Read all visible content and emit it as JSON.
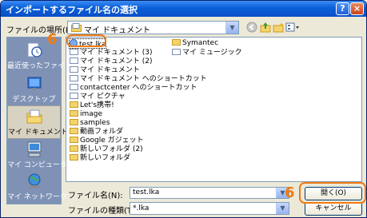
{
  "window": {
    "title": "インポートするファイル名の選択",
    "help_glyph": "?",
    "close_glyph": "×"
  },
  "lookin": {
    "label": "ファイルの場所(I):",
    "value": "マイ ドキュメント"
  },
  "toolbar": {
    "icons": [
      "back-icon",
      "up-folder-icon",
      "new-folder-icon",
      "view-menu-icon"
    ]
  },
  "places": [
    {
      "label": "最近使ったファイル",
      "icon": "recent-icon"
    },
    {
      "label": "デスクトップ",
      "icon": "desktop-icon"
    },
    {
      "label": "マイ ドキュメント",
      "icon": "my-documents-icon"
    },
    {
      "label": "マイ コンピュータ",
      "icon": "my-computer-icon"
    },
    {
      "label": "マイ ネットワーク",
      "icon": "my-network-icon"
    }
  ],
  "files": {
    "col1": [
      "test.lka",
      "マイ ドキュメント (3)",
      "マイ ドキュメント (2)",
      "マイ ドキュメント",
      "マイ ドキュメント へのショートカット",
      "contactcenter へのショートカット",
      "マイ ピクチャ",
      "Let's携帯!",
      "image",
      "samples",
      "動画フォルダ",
      "Google ガジェット",
      "新しいフォルダ (2)",
      "新しいフォルダ"
    ],
    "col2": [
      "Symantec",
      "マイ ミュージック"
    ]
  },
  "annotations": {
    "step_marker": "6"
  },
  "filename": {
    "label": "ファイル名(N):",
    "value": "test.lka"
  },
  "filetype": {
    "label": "ファイルの種類(T):",
    "value": "*.lka"
  },
  "buttons": {
    "open": "開く(O)",
    "cancel": "キャンセル"
  }
}
